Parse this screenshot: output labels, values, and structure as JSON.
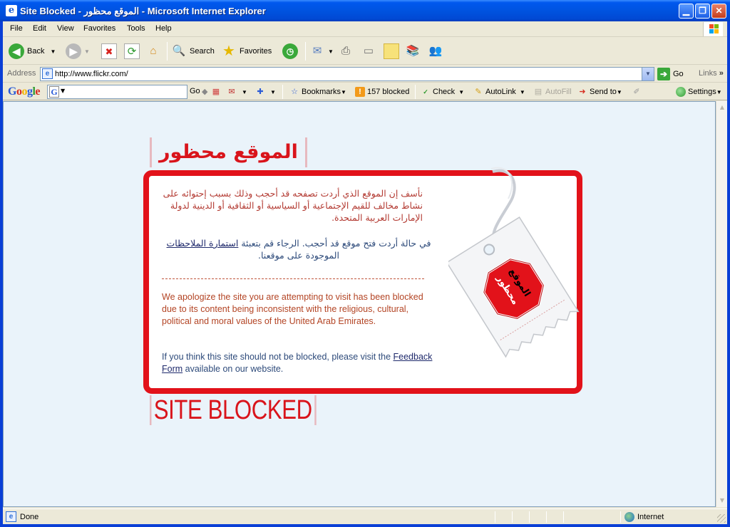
{
  "window": {
    "title": "Site Blocked - الموقع محظور - Microsoft Internet Explorer",
    "minimize": "▁",
    "maximize": "❐",
    "close": "✕"
  },
  "menu": [
    "File",
    "Edit",
    "View",
    "Favorites",
    "Tools",
    "Help"
  ],
  "toolbar": {
    "back": "Back",
    "search": "Search",
    "favorites": "Favorites"
  },
  "address": {
    "label": "Address",
    "url": "http://www.flickr.com/",
    "go": "Go",
    "links": "Links"
  },
  "googlebar": {
    "logo": "Google",
    "go": "Go",
    "bookmarks": "Bookmarks",
    "blocked": "157 blocked",
    "check": "Check",
    "autolink": "AutoLink",
    "autofill": "AutoFill",
    "sendto": "Send to",
    "settings": "Settings"
  },
  "page": {
    "ar_title": "الموقع محظور",
    "ar_para1": "نأسف إن الموقع الذي أردت تصفحه قد أحجب وذلك بسبب إحتوائه على نشاط مخالف للقيم الإجتماعية أو السياسية أو الثقافية أو الدينية لدولة الإمارات العربية المتحدة.",
    "ar_para2_text": "في حالة أردت فتح موقع قد أحجب. الرجاء قم بتعبئة",
    "ar_para2_link": "استمارة الملاحظات",
    "ar_para2_end": "الموجودة على موقعنا.",
    "divider": "--------------------------------------------------------------------------",
    "en_para1": "We apologize the site you are attempting to visit has been blocked due to its content being inconsistent with the religious, cultural, political and moral values of the United Arab Emirates.",
    "en_para2_start": "If you think this site should not be blocked, please visit the",
    "en_para2_link": "Feedback Form",
    "en_para2_end": "available on our website.",
    "tag_ar_line1": "الموقع",
    "tag_ar_line2": "محظور",
    "en_title": "SITE BLOCKED"
  },
  "status": {
    "done": "Done",
    "zone": "Internet"
  },
  "colors": {
    "accent_red": "#e2121a",
    "content_bg": "#eaf3fa",
    "xp_blue": "#0a3fd6"
  }
}
